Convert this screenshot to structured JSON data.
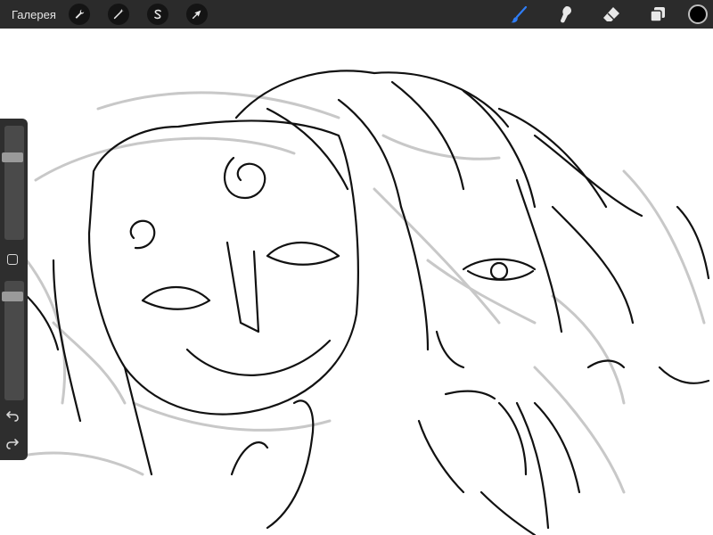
{
  "topbar": {
    "gallery_label": "Галерея",
    "left_tools": [
      {
        "name": "actions",
        "icon": "wrench-icon"
      },
      {
        "name": "adjustments",
        "icon": "magic-wand-icon"
      },
      {
        "name": "selection",
        "icon": "selection-s-icon"
      },
      {
        "name": "transform",
        "icon": "arrow-cursor-icon"
      }
    ],
    "right_tools": [
      {
        "name": "brush",
        "icon": "brush-icon",
        "active": true
      },
      {
        "name": "smudge",
        "icon": "smudge-icon",
        "active": false
      },
      {
        "name": "eraser",
        "icon": "eraser-icon",
        "active": false
      },
      {
        "name": "layers",
        "icon": "layers-icon",
        "active": false
      }
    ],
    "color": "#000000"
  },
  "sidebar": {
    "brush_size": 0.26,
    "opacity": 0.1
  },
  "colors": {
    "bar": "#2b2b2b",
    "active_tool": "#2f7df6",
    "sidebar": "#2e2e2e"
  }
}
